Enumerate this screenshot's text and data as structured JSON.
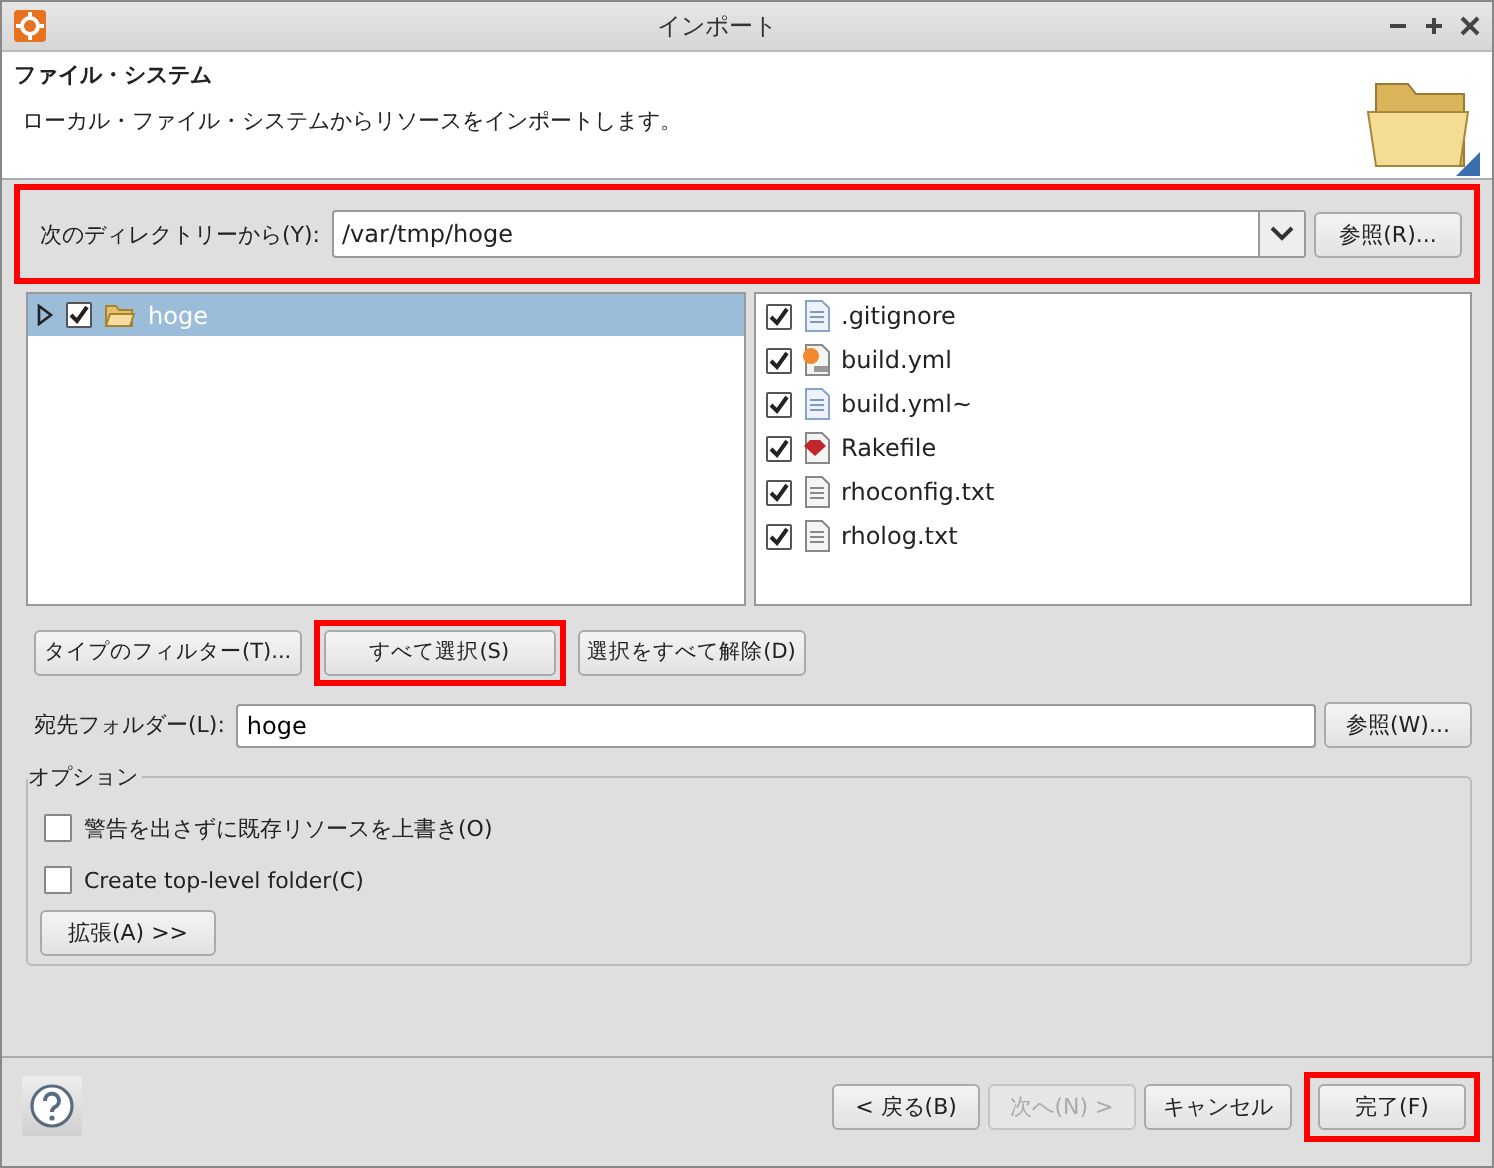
{
  "window": {
    "title": "インポート"
  },
  "header": {
    "title": "ファイル・システム",
    "description": "ローカル・ファイル・システムからリソースをインポートします。"
  },
  "source": {
    "label": "次のディレクトリーから(Y):",
    "value": "/var/tmp/hoge",
    "browse": "参照(R)...",
    "highlighted": true
  },
  "tree": [
    {
      "label": "hoge",
      "checked": true,
      "selected": true,
      "expanded": false
    }
  ],
  "files": [
    {
      "name": ".gitignore",
      "checked": true,
      "kind": "text"
    },
    {
      "name": "build.yml",
      "checked": true,
      "kind": "yaml"
    },
    {
      "name": "build.yml~",
      "checked": true,
      "kind": "text"
    },
    {
      "name": "Rakefile",
      "checked": true,
      "kind": "ruby"
    },
    {
      "name": "rhoconfig.txt",
      "checked": true,
      "kind": "plain"
    },
    {
      "name": "rholog.txt",
      "checked": true,
      "kind": "plain"
    }
  ],
  "selection_buttons": [
    {
      "label": "タイプのフィルター(T)...",
      "highlighted": false
    },
    {
      "label": "すべて選択(S)",
      "highlighted": true
    },
    {
      "label": "選択をすべて解除(D)",
      "highlighted": false
    }
  ],
  "destination": {
    "label": "宛先フォルダー(L):",
    "value": "hoge",
    "browse": "参照(W)..."
  },
  "options": {
    "legend": "オプション",
    "checkboxes": [
      {
        "label": "警告を出さずに既存リソースを上書き(O)",
        "checked": false
      },
      {
        "label": "Create top-level folder(C)",
        "checked": false
      }
    ],
    "advanced": "拡張(A) >>"
  },
  "footer_buttons": [
    {
      "label": "< 戻る(B)",
      "disabled": false,
      "highlighted": false
    },
    {
      "label": "次へ(N) >",
      "disabled": true,
      "highlighted": false
    },
    {
      "label": "キャンセル",
      "disabled": false,
      "highlighted": false
    },
    {
      "label": "完了(F)",
      "disabled": false,
      "highlighted": true
    }
  ]
}
